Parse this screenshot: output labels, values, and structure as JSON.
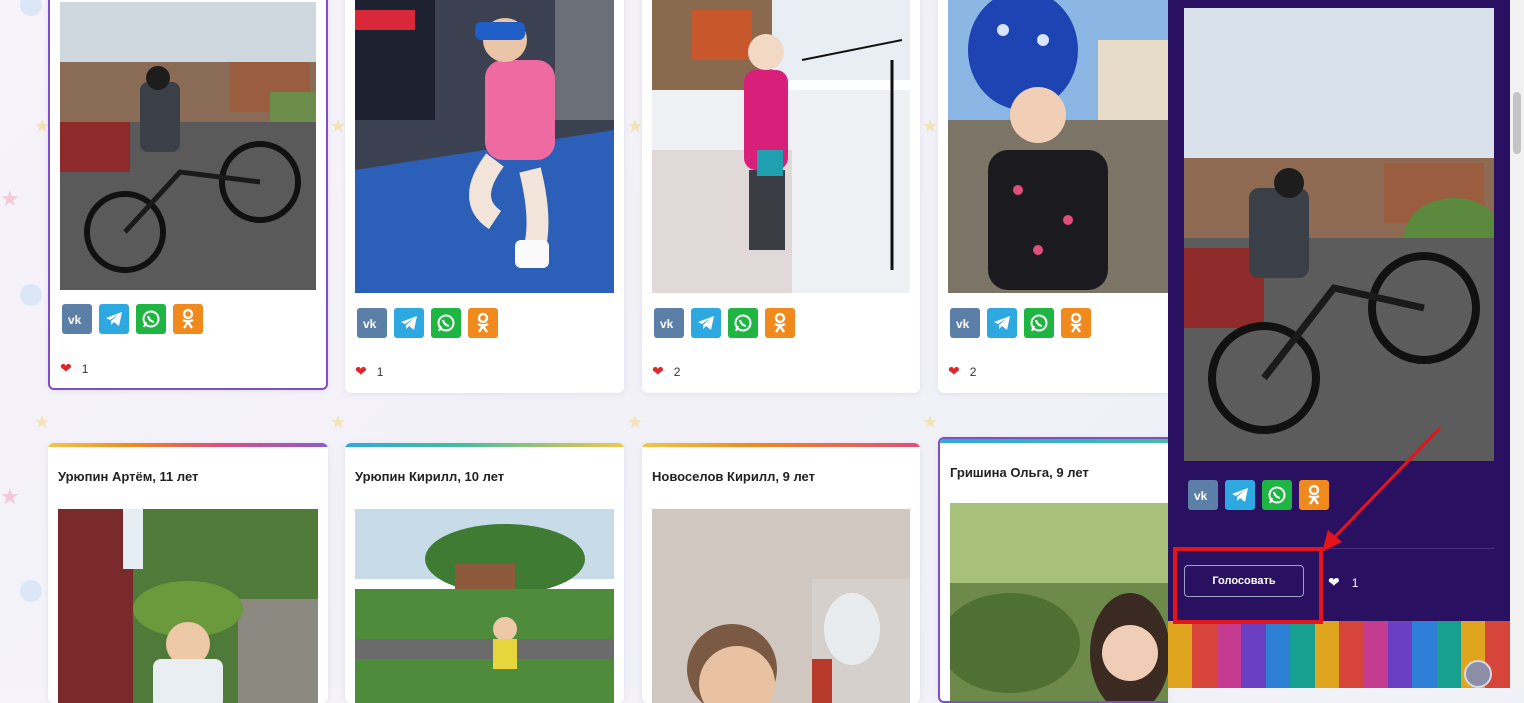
{
  "cards_top": [
    {
      "likes": "1"
    },
    {
      "likes": "1"
    },
    {
      "likes": "2"
    },
    {
      "likes": "2"
    }
  ],
  "cards_bottom": [
    {
      "name": "Урюпин Артём, 11 лет"
    },
    {
      "name": "Урюпин Кирилл, 10 лет"
    },
    {
      "name": "Новоселов Кирилл, 9 лет"
    },
    {
      "name": "Гришина Ольга, 9 лет"
    }
  ],
  "share_icons": [
    "vk-icon",
    "telegram-icon",
    "whatsapp-icon",
    "odnoklassniki-icon"
  ],
  "panel": {
    "vote_label": "Голосовать",
    "likes": "1"
  },
  "colors": {
    "vk": "#5b7fa6",
    "telegram": "#2ea8e0",
    "whatsapp": "#1fb543",
    "odnoklassniki": "#f08a1c",
    "panel_bg": "#2a1060",
    "heart": "#e0262b",
    "selection": "#7f4ec8",
    "annotation_red": "#e4141c"
  }
}
